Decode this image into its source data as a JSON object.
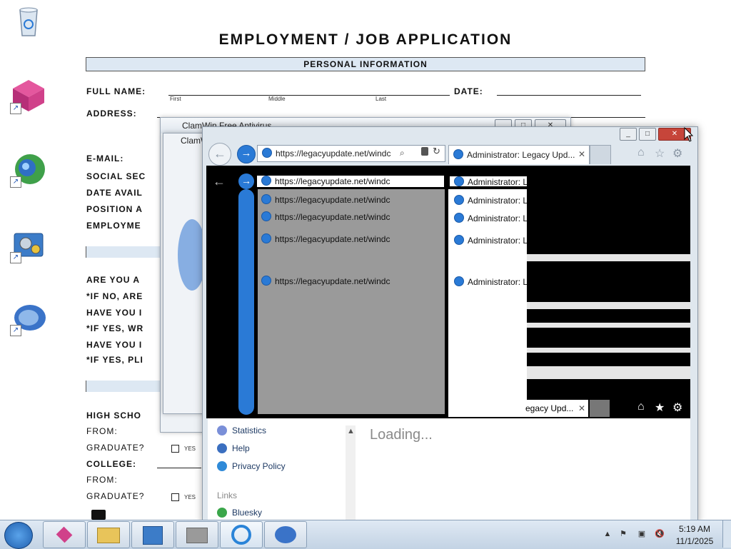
{
  "document": {
    "title": "EMPLOYMENT / JOB APPLICATION",
    "section_personal": "PERSONAL INFORMATION",
    "full_name_label": "FULL NAME:",
    "date_label": "DATE:",
    "first": "First",
    "middle": "Middle",
    "last": "Last",
    "address_label": "ADDRESS:",
    "email_label": "E-MAIL:",
    "social_label": "SOCIAL SEC",
    "date_avail_label": "DATE AVAIL",
    "position_label": "POSITION A",
    "employment_label": "EMPLOYME",
    "are_you_label": "ARE YOU A",
    "if_no_label": "*IF NO, ARE",
    "have_you_1": "HAVE YOU I",
    "if_yes_wr": "*IF YES, WR",
    "have_you_2": "HAVE YOU I",
    "if_yes_pl": "*IF YES, PLI",
    "high_school_label": "HIGH SCHO",
    "from_label_1": "FROM:",
    "graduate_label_1": "GRADUATE?",
    "yes_1": "YES",
    "college_label": "COLLEGE:",
    "from_label_2": "FROM:",
    "graduate_label_2": "GRADUATE?",
    "yes_2": "YES"
  },
  "clamwin": {
    "title_1": "ClamWin Free Antivirus",
    "title_2": "ClamW"
  },
  "browser": {
    "url": "https://legacyupdate.net/windc",
    "tab_title": "Administrator: Legacy Upd...",
    "tab_title_short": "Administrator: L",
    "tab_title_tail": "egacy Upd...",
    "loading_text": "Loading...",
    "sidebar": [
      "Statistics",
      "Help",
      "Privacy Policy"
    ],
    "links_header": "Links",
    "links": [
      "Bluesky"
    ]
  },
  "taskbar": {
    "time": "5:19 AM",
    "date": "11/1/2025"
  },
  "icons": {
    "recycle": "recycle-bin-icon",
    "app1": "pink-cube-app-icon",
    "app2": "globe-network-app-icon",
    "app3": "settings-tool-app-icon",
    "app4": "clamwin-app-icon"
  },
  "colors": {
    "accent": "#2a7ad6",
    "form_bar": "#dde8f3",
    "close": "#c6453a"
  }
}
